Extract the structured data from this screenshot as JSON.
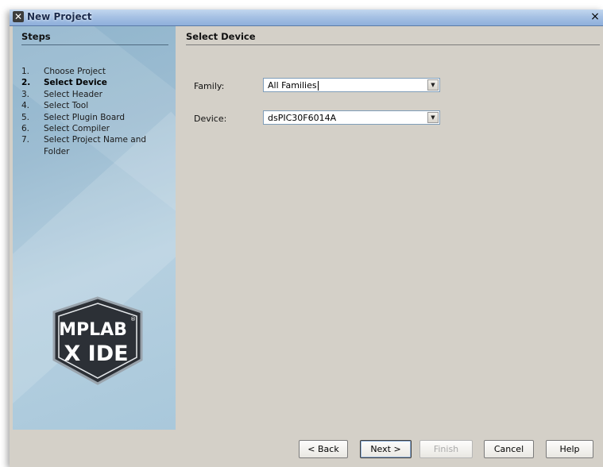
{
  "window": {
    "title": "New Project",
    "close_symbol": "×"
  },
  "steps": {
    "heading": "Steps",
    "items": [
      {
        "num": "1.",
        "label": "Choose Project"
      },
      {
        "num": "2.",
        "label": "Select Device"
      },
      {
        "num": "3.",
        "label": "Select Header"
      },
      {
        "num": "4.",
        "label": "Select Tool"
      },
      {
        "num": "5.",
        "label": "Select Plugin Board"
      },
      {
        "num": "6.",
        "label": "Select Compiler"
      },
      {
        "num": "7.",
        "label": "Select Project Name and Folder"
      }
    ],
    "active_index": 1
  },
  "logo": {
    "line1": "MPLAB",
    "registered": "®",
    "line2": "X IDE"
  },
  "content": {
    "heading": "Select Device",
    "family_label": "Family:",
    "family_value": "All Families",
    "device_label": "Device:",
    "device_value": "dsPIC30F6014A"
  },
  "buttons": {
    "back": "< Back",
    "next": "Next >",
    "finish": "Finish",
    "cancel": "Cancel",
    "help": "Help"
  },
  "icons": {
    "app": "mplab-x-icon",
    "close": "close-icon",
    "dropdown": "chevron-down-icon"
  }
}
